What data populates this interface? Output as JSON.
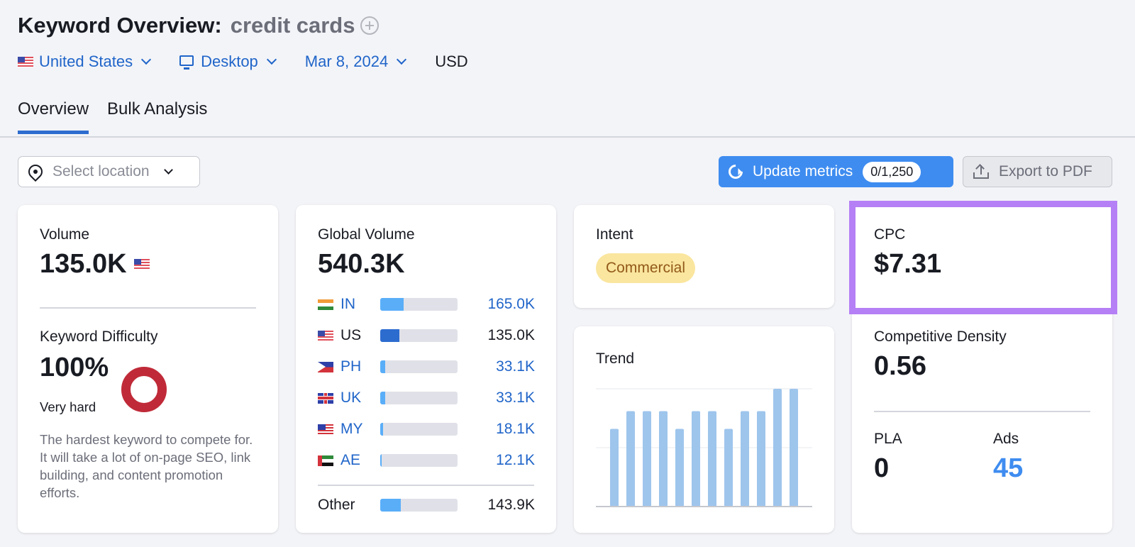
{
  "header": {
    "title": "Keyword Overview:",
    "keyword": "credit cards",
    "add_icon": "plus-circle-icon"
  },
  "filters": {
    "country": "United States",
    "device": "Desktop",
    "date": "Mar 8, 2024",
    "currency": "USD"
  },
  "tabs": [
    {
      "label": "Overview",
      "active": true
    },
    {
      "label": "Bulk Analysis",
      "active": false
    }
  ],
  "toolbar": {
    "location_placeholder": "Select location",
    "update_label": "Update metrics",
    "update_counter": "0/1,250",
    "export_label": "Export to PDF",
    "accent": "#3e8cf0"
  },
  "volume": {
    "label": "Volume",
    "value": "135.0K"
  },
  "keyword_difficulty": {
    "label": "Keyword Difficulty",
    "value": "100%",
    "level": "Very hard",
    "percent": 100,
    "color": "#c02a38",
    "description": "The hardest keyword to compete for. It will take a lot of on-page SEO, link building, and content promotion efforts."
  },
  "global_volume": {
    "label": "Global Volume",
    "value": "540.3K",
    "countries": [
      {
        "code": "IN",
        "value": "165.0K",
        "share": 0.305,
        "link": true
      },
      {
        "code": "US",
        "value": "135.0K",
        "share": 0.25,
        "link": false
      },
      {
        "code": "PH",
        "value": "33.1K",
        "share": 0.061,
        "link": true
      },
      {
        "code": "UK",
        "value": "33.1K",
        "share": 0.061,
        "link": true
      },
      {
        "code": "MY",
        "value": "18.1K",
        "share": 0.034,
        "link": true
      },
      {
        "code": "AE",
        "value": "12.1K",
        "share": 0.022,
        "link": true
      }
    ],
    "other": {
      "label": "Other",
      "value": "143.9K",
      "share": 0.266
    }
  },
  "intent": {
    "label": "Intent",
    "value": "Commercial"
  },
  "trend": {
    "label": "Trend"
  },
  "chart_data": {
    "type": "bar",
    "title": "Trend",
    "categories": [
      "1",
      "2",
      "3",
      "4",
      "5",
      "6",
      "7",
      "8",
      "9",
      "10",
      "11",
      "12"
    ],
    "values": [
      0.66,
      0.81,
      0.81,
      0.81,
      0.66,
      0.81,
      0.81,
      0.66,
      0.81,
      0.81,
      1.0,
      1.0
    ],
    "ylim": [
      0,
      1
    ],
    "grid": true
  },
  "cpc": {
    "label": "CPC",
    "value": "$7.31"
  },
  "competitive_density": {
    "label": "Competitive Density",
    "value": "0.56"
  },
  "pla": {
    "label": "PLA",
    "value": "0"
  },
  "ads": {
    "label": "Ads",
    "value": "45"
  }
}
